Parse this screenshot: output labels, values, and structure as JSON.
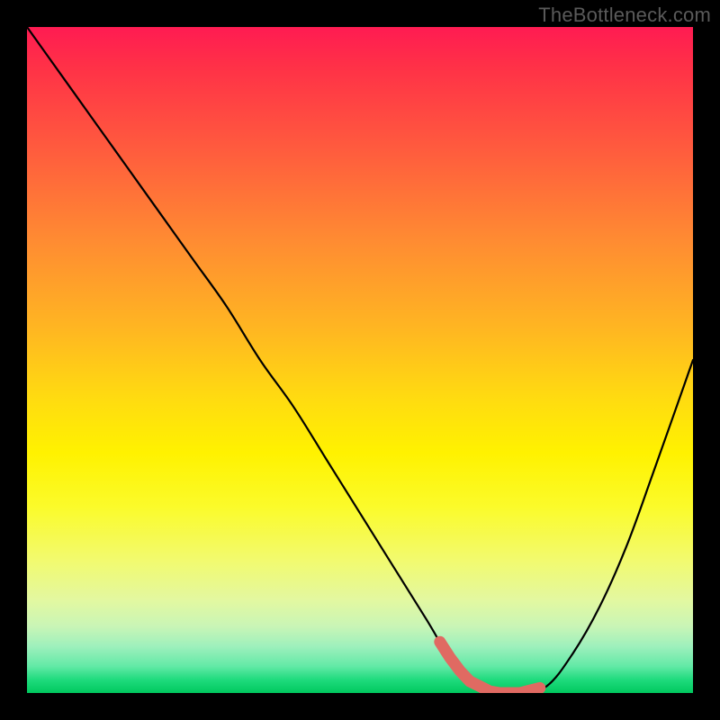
{
  "watermark": "TheBottleneck.com",
  "colors": {
    "background": "#000000",
    "watermark_text": "#5a5a5a",
    "curve_stroke": "#000000",
    "highlight_stroke": "#e06a62",
    "gradient_top": "#ff1b52",
    "gradient_mid": "#fff200",
    "gradient_bottom": "#00c85e"
  },
  "chart_data": {
    "type": "line",
    "title": "",
    "xlabel": "",
    "ylabel": "",
    "xlim": [
      0,
      100
    ],
    "ylim": [
      0,
      100
    ],
    "grid": false,
    "legend": false,
    "annotations": [],
    "series": [
      {
        "name": "bottleneck_curve",
        "x": [
          0,
          5,
          10,
          15,
          20,
          25,
          30,
          35,
          40,
          45,
          50,
          55,
          60,
          63,
          66,
          70,
          74,
          78,
          82,
          86,
          90,
          94,
          100
        ],
        "y_pct": [
          100,
          93,
          86,
          79,
          72,
          65,
          58,
          50,
          43,
          35,
          27,
          19,
          11,
          6,
          2,
          0,
          0,
          1,
          6,
          13,
          22,
          33,
          50
        ]
      }
    ],
    "highlight_segment": {
      "series": "bottleneck_curve",
      "x_start": 62,
      "x_end": 77,
      "meaning": "optimal / no-bottleneck region near curve minimum"
    }
  }
}
